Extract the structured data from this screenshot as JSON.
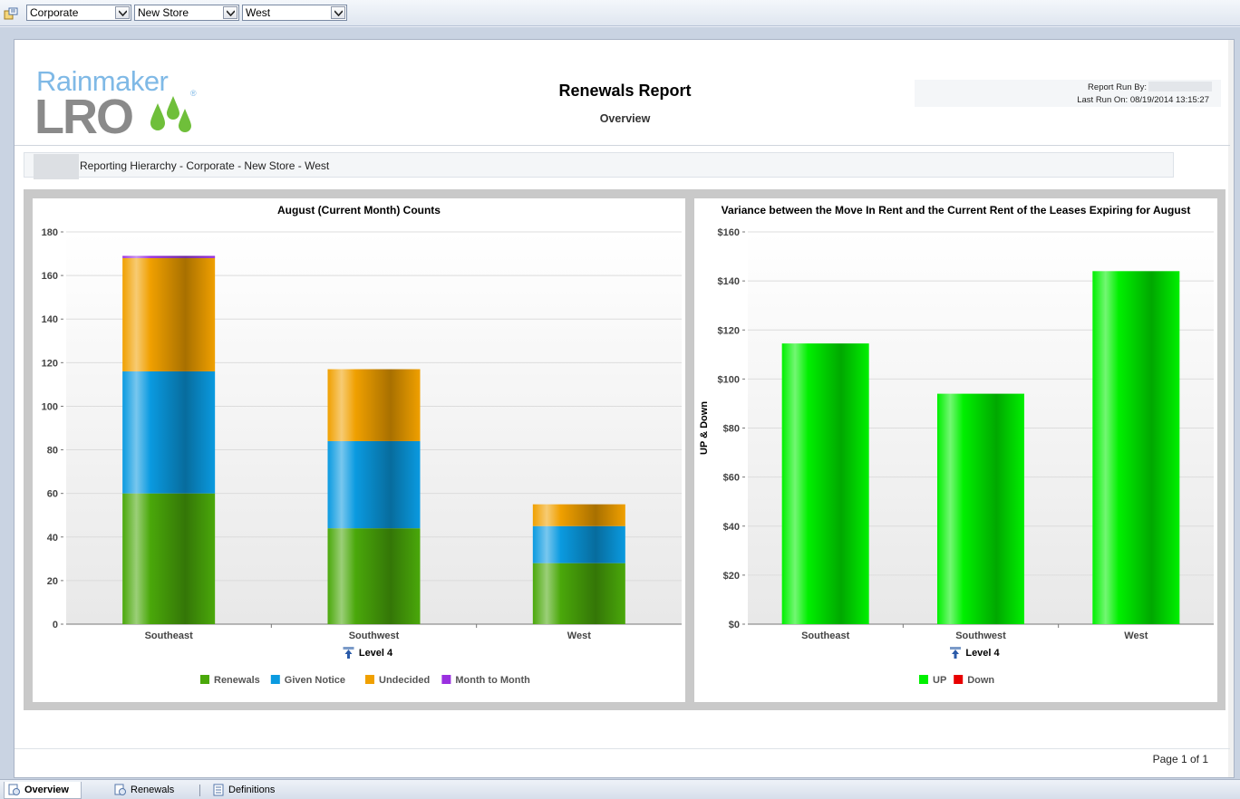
{
  "toolbar": {
    "dropdowns": [
      {
        "value": "Corporate"
      },
      {
        "value": "New Store"
      },
      {
        "value": "West"
      }
    ]
  },
  "header": {
    "logo_top": "Rainmaker",
    "logo_bottom": "LRO",
    "logo_reg": "®",
    "title": "Renewals Report",
    "subtitle": "Overview",
    "run_by_label": "Report Run By:",
    "last_run": "Last Run On: 08/19/2014 13:15:27"
  },
  "breadcrumb": "Reporting Hierarchy - Corporate - New Store - West",
  "footer": {
    "page": "Page 1 of 1"
  },
  "tabs": [
    {
      "label": "Overview",
      "icon": "report-icon",
      "active": true
    },
    {
      "label": "Renewals",
      "icon": "report-icon",
      "active": false
    },
    {
      "label": "Definitions",
      "icon": "document-icon",
      "active": false
    }
  ],
  "chart_data": [
    {
      "type": "bar",
      "stacked": true,
      "title": "August (Current Month) Counts",
      "xlabel": "Level 4",
      "ylabel": "",
      "categories": [
        "Southeast",
        "Southwest",
        "West"
      ],
      "ylim": [
        0,
        180
      ],
      "yticks": [
        0,
        20,
        40,
        60,
        80,
        100,
        120,
        140,
        160,
        180
      ],
      "ytick_labels": [
        "0",
        "20",
        "40",
        "60",
        "80",
        "100",
        "120",
        "140",
        "160",
        "180"
      ],
      "legend_position": "bottom",
      "series": [
        {
          "name": "Renewals",
          "color": "#4aa80a",
          "values": [
            60,
            44,
            28
          ]
        },
        {
          "name": "Given Notice",
          "color": "#0a9ae0",
          "values": [
            56,
            40,
            17
          ]
        },
        {
          "name": "Undecided",
          "color": "#f0a000",
          "values": [
            52,
            33,
            10
          ]
        },
        {
          "name": "Month to Month",
          "color": "#9a30e0",
          "values": [
            1,
            0,
            0
          ]
        }
      ]
    },
    {
      "type": "bar",
      "stacked": true,
      "title": "Variance between the Move In Rent and the Current Rent of the Leases Expiring for August",
      "xlabel": "Level 4",
      "ylabel": "UP & Down",
      "categories": [
        "Southeast",
        "Southwest",
        "West"
      ],
      "ylim": [
        0,
        160
      ],
      "yticks": [
        0,
        20,
        40,
        60,
        80,
        100,
        120,
        140,
        160
      ],
      "ytick_labels": [
        "$0",
        "$20",
        "$40",
        "$60",
        "$80",
        "$100",
        "$120",
        "$140",
        "$160"
      ],
      "legend_position": "bottom",
      "series": [
        {
          "name": "UP",
          "color": "#00f000",
          "values": [
            114.5,
            94,
            144
          ]
        },
        {
          "name": "Down",
          "color": "#e80000",
          "values": [
            0,
            0,
            0
          ]
        }
      ]
    }
  ]
}
